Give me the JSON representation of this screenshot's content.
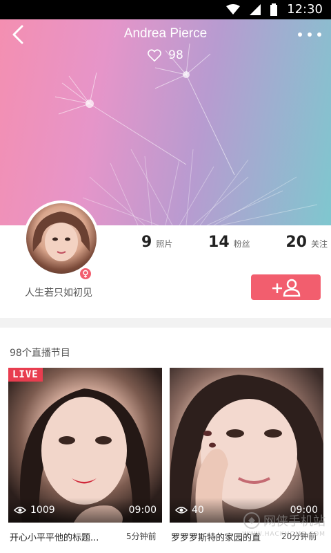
{
  "status_bar": {
    "time": "12:30"
  },
  "header": {
    "title": "Andrea Pierce",
    "likes": "98"
  },
  "profile": {
    "signature": "人生若只如初见",
    "stats": [
      {
        "value": "9",
        "label": "照片"
      },
      {
        "value": "14",
        "label": "粉丝"
      },
      {
        "value": "20",
        "label": "关注"
      }
    ]
  },
  "programs": {
    "title": "98个直播节目",
    "items": [
      {
        "badge": "LIVE",
        "viewers": "1009",
        "duration": "09:00",
        "title": "开心小平平他的标题...",
        "time": "5分钟前"
      },
      {
        "badge": "",
        "viewers": "40",
        "duration": "09:00",
        "title": "罗罗罗斯特的家园的直",
        "time": "20分钟前"
      }
    ]
  },
  "watermark": {
    "text": "网侠手机站",
    "sub": "WWW.HACKHOME.COM"
  },
  "colors": {
    "accent": "#f25e6e",
    "live_badge": "#e83d4f"
  }
}
